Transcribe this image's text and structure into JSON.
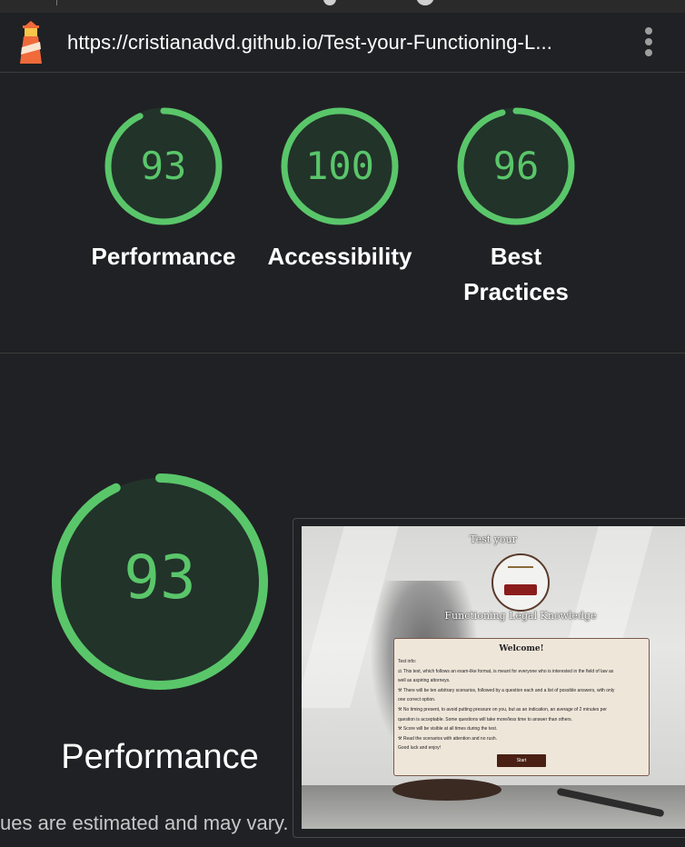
{
  "url": "https://cristianadvd.github.io/Test-your-Functioning-L...",
  "colors": {
    "good": "#0cce6b",
    "ring": "#5ac66a",
    "ring_bg": "#22332a",
    "score_text": "#5ac66a"
  },
  "scores": [
    {
      "value": "93",
      "label": "Performance",
      "fraction": 0.93
    },
    {
      "value": "100",
      "label": "Accessibility",
      "fraction": 1.0
    },
    {
      "value": "96",
      "label": "Best Practices",
      "label_line1": "Best",
      "label_line2": "Practices",
      "fraction": 0.96
    }
  ],
  "main": {
    "score": "93",
    "fraction": 0.93,
    "title": "Performance",
    "note": "ues are estimated and may vary. The"
  },
  "preview": {
    "title_top": "Test your",
    "title_bottom": "Functioning Legal Knowledge",
    "welcome": "Welcome!",
    "info_lines": [
      "Test info:",
      "⚖ This test, which follows an exam-like format, is meant for everyone who is interested in the field of law as",
      "well as aspiring attorneys.",
      "⚒ There will be ten arbitrary scenarios, followed by a question each and a list of possible answers, with only",
      "one correct option.",
      "⚒ No timing present, to avoid putting pressure on you, but as an indication, an average of 2 minutes per",
      "question is acceptable. Some questions will take more/less time to answer than others.",
      "⚒ Score will be visible at all times during the test.",
      "⚒ Read the scenarios with attention and no rush.",
      "Good luck and enjoy!"
    ],
    "start_label": "Start"
  }
}
